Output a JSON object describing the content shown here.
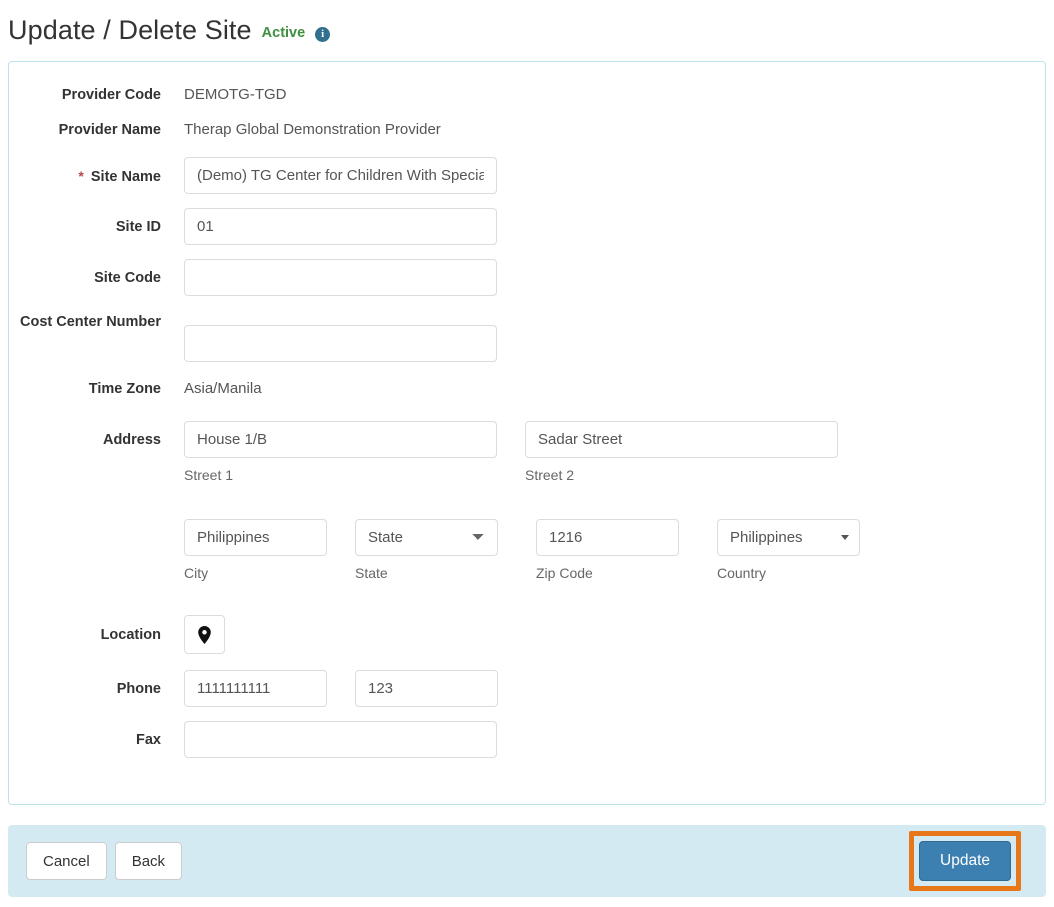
{
  "header": {
    "title": "Update / Delete Site",
    "status": "Active",
    "info_icon": "info-icon",
    "status_color": "#3e8f3e",
    "info_icon_color": "#31708f",
    "info_glyph": "i"
  },
  "form": {
    "provider_code": {
      "label": "Provider Code",
      "value": "DEMOTG-TGD"
    },
    "provider_name": {
      "label": "Provider Name",
      "value": "Therap Global Demonstration Provider"
    },
    "site_name": {
      "label": "Site Name",
      "required_marker": "*",
      "value": "(Demo) TG Center for Children With Special Needs"
    },
    "site_id": {
      "label": "Site ID",
      "value": "01"
    },
    "site_code": {
      "label": "Site Code",
      "value": ""
    },
    "cost_center_number": {
      "label": "Cost Center Number",
      "value": ""
    },
    "time_zone": {
      "label": "Time Zone",
      "value": "Asia/Manila"
    },
    "address": {
      "label": "Address",
      "street1": {
        "value": "House 1/B",
        "sub_label": "Street 1"
      },
      "street2": {
        "value": "Sadar Street",
        "sub_label": "Street 2"
      },
      "city": {
        "value": "Philippines",
        "sub_label": "City"
      },
      "state": {
        "value": "State",
        "sub_label": "State",
        "options": [
          "State"
        ]
      },
      "zip": {
        "value": "1216",
        "sub_label": "Zip Code"
      },
      "country": {
        "value": "Philippines",
        "sub_label": "Country"
      }
    },
    "location": {
      "label": "Location",
      "icon": "map-pin-icon"
    },
    "phone": {
      "label": "Phone",
      "number": "1111111111",
      "extension": "123"
    },
    "fax": {
      "label": "Fax",
      "value": ""
    }
  },
  "footer": {
    "cancel_label": "Cancel",
    "back_label": "Back",
    "update_label": "Update",
    "update_color": "#3c7fb1",
    "highlight_color": "#e8771a",
    "bar_color": "#d4eaf3"
  }
}
